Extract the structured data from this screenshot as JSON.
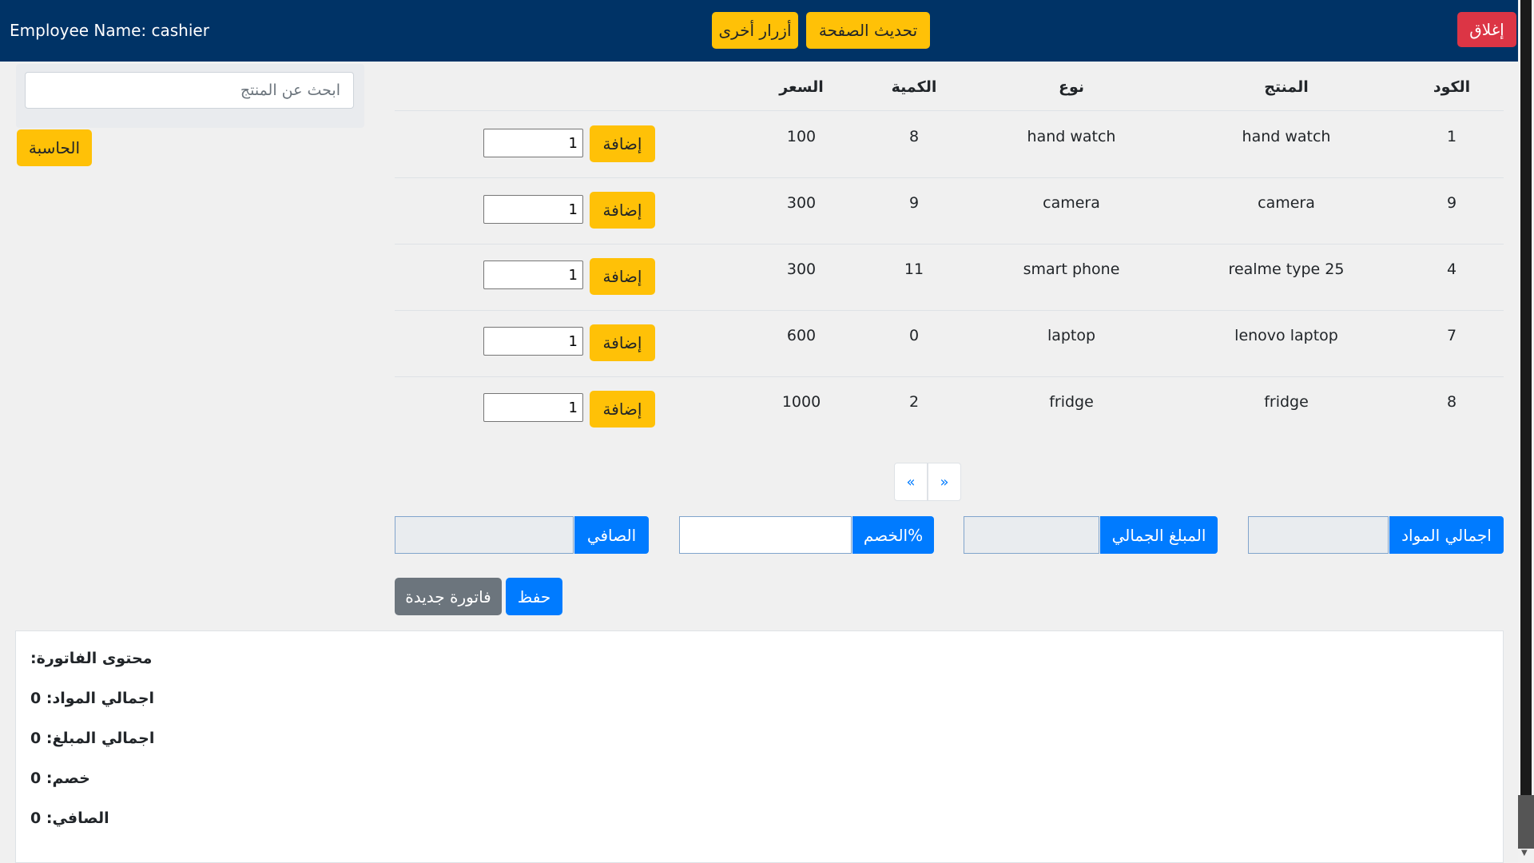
{
  "header": {
    "employee_name": "Employee Name: cashier",
    "refresh_label": "تحديث الصفحة",
    "other_buttons_label": "أزرار أخرى",
    "close_label": "إغلاق"
  },
  "search": {
    "placeholder": "ابحث عن المنتج"
  },
  "calculator_label": "الحاسبة",
  "table": {
    "headers": {
      "code": "الكود",
      "product": "المنتج",
      "type": "نوع",
      "quantity": "الكمية",
      "price": "السعر"
    },
    "add_label": "إضافة",
    "rows": [
      {
        "code": "1",
        "product": "hand watch",
        "type": "hand watch",
        "quantity": "8",
        "price": "100",
        "qty_input": "1"
      },
      {
        "code": "9",
        "product": "camera",
        "type": "camera",
        "quantity": "9",
        "price": "300",
        "qty_input": "1"
      },
      {
        "code": "4",
        "product": "realme type 25",
        "type": "smart phone",
        "quantity": "11",
        "price": "300",
        "qty_input": "1"
      },
      {
        "code": "7",
        "product": "lenovo laptop",
        "type": "laptop",
        "quantity": "0",
        "price": "600",
        "qty_input": "1"
      },
      {
        "code": "8",
        "product": "fridge",
        "type": "fridge",
        "quantity": "2",
        "price": "1000",
        "qty_input": "1"
      }
    ]
  },
  "pagination": {
    "prev": "«",
    "next": "»"
  },
  "summary": {
    "total_items_label": "اجمالي المواد",
    "total_amount_label": "المبلغ الجمالي",
    "discount_label": "الخصم%",
    "net_label": "الصافي"
  },
  "actions": {
    "save_label": "حفظ",
    "new_invoice_label": "فاتورة جديدة"
  },
  "invoice": {
    "title": "محتوى الفاتورة:",
    "total_items": "اجمالي المواد: 0",
    "total_amount": "اجمالي المبلغ: 0",
    "discount": "خصم: 0",
    "net": "الصافي: 0"
  },
  "colors": {
    "header_bg": "#003366",
    "yellow": "#ffc107",
    "red": "#dc3545",
    "blue": "#007bff",
    "gray": "#6c757d"
  }
}
